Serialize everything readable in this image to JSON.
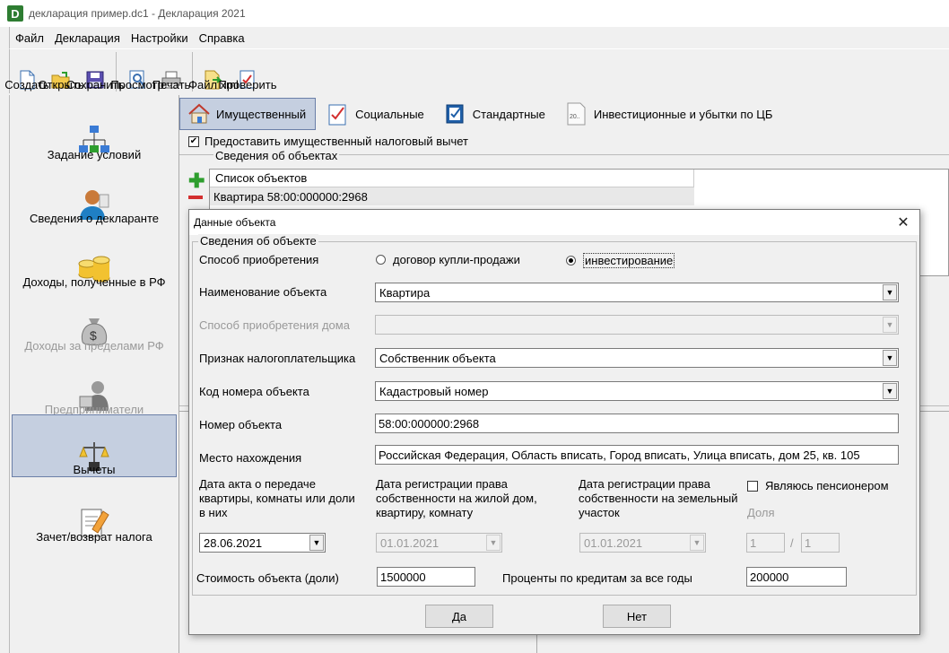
{
  "window": {
    "title": "декларация пример.dc1 - Декларация 2021",
    "app_icon": "D"
  },
  "menu": [
    "Файл",
    "Декларация",
    "Настройки",
    "Справка"
  ],
  "toolbar": [
    {
      "label": "Создать",
      "icon": "new-file-icon"
    },
    {
      "label": "Открыть",
      "icon": "open-folder-icon"
    },
    {
      "label": "Сохранить",
      "icon": "floppy-disk-icon"
    },
    {
      "label": "Просмотр",
      "icon": "preview-icon"
    },
    {
      "label": "Печать",
      "icon": "printer-icon"
    },
    {
      "label": "Файл xml",
      "icon": "xml-file-icon"
    },
    {
      "label": "Проверить",
      "icon": "check-document-icon"
    }
  ],
  "sidebar": [
    {
      "label": "Задание условий",
      "icon": "hierarchy-icon",
      "disabled": false
    },
    {
      "label": "Сведения о декларанте",
      "icon": "person-icon",
      "disabled": false
    },
    {
      "label": "Доходы, полученные в РФ",
      "icon": "coins-icon",
      "disabled": false
    },
    {
      "label": "Доходы за пределами РФ",
      "icon": "money-bag-icon",
      "disabled": true
    },
    {
      "label": "Предприниматели",
      "icon": "businessman-icon",
      "disabled": true
    },
    {
      "label": "Вычеты",
      "icon": "scales-icon",
      "disabled": false,
      "active": true
    },
    {
      "label": "Зачет/возврат налога",
      "icon": "document-pen-icon",
      "disabled": false
    }
  ],
  "tabs": [
    {
      "label": "Имущественный",
      "icon": "house-icon",
      "active": true
    },
    {
      "label": "Социальные",
      "icon": "checklist-icon"
    },
    {
      "label": "Стандартные",
      "icon": "check-card-icon"
    },
    {
      "label": "Инвестиционные и убытки по ЦБ",
      "icon": "document-20-icon"
    }
  ],
  "main": {
    "provide_deduction_label": "Предоставить имущественный налоговый вычет",
    "provide_deduction_checked": true,
    "objects_group_label": "Сведения об объектах",
    "list_header": "Список объектов",
    "list_rows": [
      "Квартира 58:00:000000:2968"
    ]
  },
  "dialog": {
    "title": "Данные объекта",
    "group_label": "Сведения об объекте",
    "acquisition_method_label": "Способ приобретения",
    "radio_purchase": "договор купли-продажи",
    "radio_invest": "инвестирование",
    "selected_method": "инвестирование",
    "object_name_label": "Наименование объекта",
    "object_name_value": "Квартира",
    "house_method_label": "Способ приобретения дома",
    "house_method_value": "",
    "taxpayer_sign_label": "Признак налогоплательщика",
    "taxpayer_sign_value": "Собственник объекта",
    "object_code_label": "Код номера объекта",
    "object_code_value": "Кадастровый номер",
    "object_number_label": "Номер объекта",
    "object_number_value": "58:00:000000:2968",
    "location_label": "Место нахождения",
    "location_value": "Российская Федерация, Область вписать, Город вписать, Улица вписать, дом 25, кв. 105",
    "act_date_label": "Дата акта о передаче квартиры, комнаты или доли в них",
    "act_date_value": "28.06.2021",
    "reg_date_label": "Дата регистрации права собственности на жилой дом, квартиру, комнату",
    "reg_date_value": "01.01.2021",
    "land_date_label": "Дата регистрации права собственности на земельный участок",
    "land_date_value": "01.01.2021",
    "pensioner_label": "Являюсь пенсионером",
    "pensioner_checked": false,
    "share_label": "Доля",
    "share_num": "1",
    "share_den": "1",
    "share_sep": "/",
    "cost_label": "Стоимость объекта (доли)",
    "cost_value": "1500000",
    "interest_label": "Проценты по кредитам за все годы",
    "interest_value": "200000",
    "ok_label": "Да",
    "cancel_label": "Нет"
  }
}
